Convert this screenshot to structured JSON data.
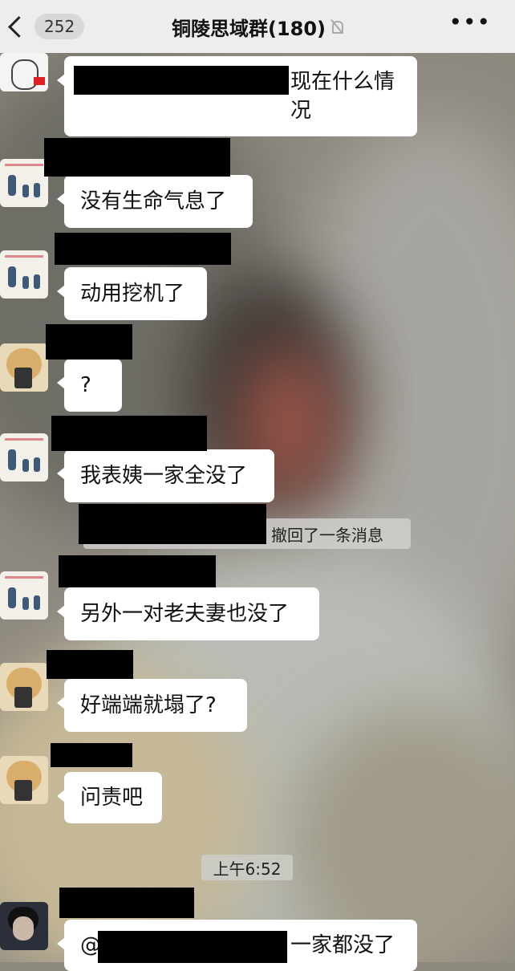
{
  "header": {
    "back_count": "252",
    "title": "铜陵思域群(180)",
    "more_label": "•••"
  },
  "messages": [
    {
      "avatar": "sketch-avatar",
      "text": "现在什么情\n况"
    },
    {
      "avatar": "figures-avatar",
      "text": "没有生命气息了"
    },
    {
      "avatar": "figures-avatar",
      "text": "动用挖机了"
    },
    {
      "avatar": "dog-avatar",
      "text": "?"
    },
    {
      "avatar": "figures-avatar",
      "text": "我表姨一家全没了"
    },
    {
      "avatar": "figures-avatar",
      "text": "另外一对老夫妻也没了"
    },
    {
      "avatar": "dog-avatar",
      "text": "好端端就塌了?"
    },
    {
      "avatar": "dog-avatar",
      "text": "问责吧"
    },
    {
      "avatar": "person-avatar",
      "mention": "@",
      "text": "一家都没了"
    }
  ],
  "recall_notice": "撤回了一条消息",
  "time_separator": "上午6:52"
}
